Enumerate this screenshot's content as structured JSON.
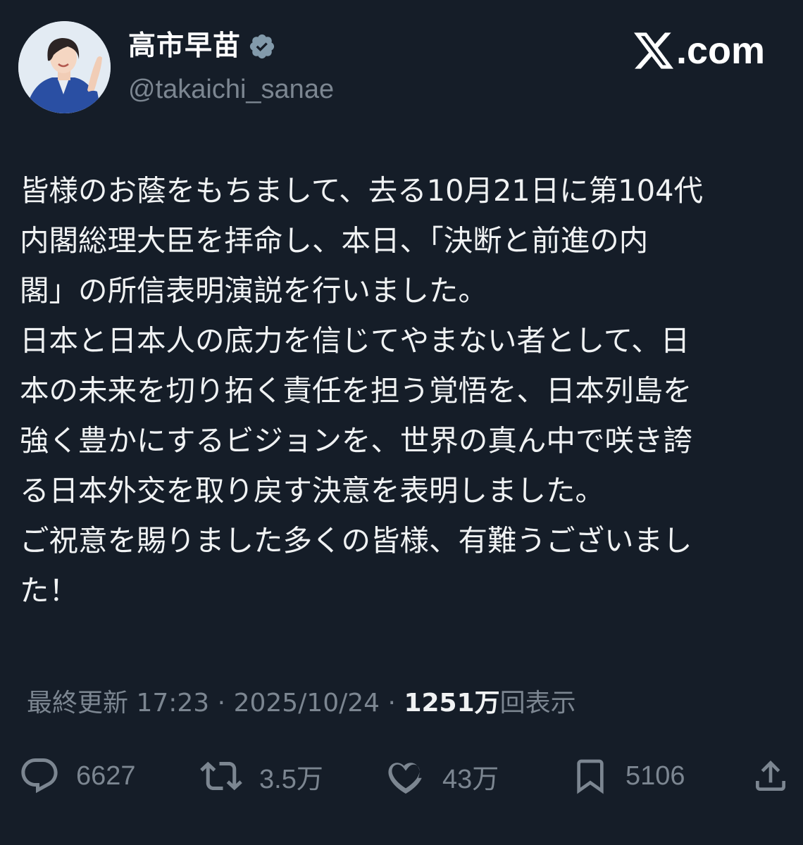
{
  "header": {
    "display_name": "高市早苗",
    "handle": "@takaichi_sanae",
    "brand": ".com"
  },
  "tweet": {
    "text": "皆様のお蔭をもちまして、去る10月21日に第104代\n内閣総理大臣を拝命し、本日、「決断と前進の内\n閣」の所信表明演説を行いました。\n日本と日本人の底力を信じてやまない者として、日\n本の未来を切り拓く責任を担う覚悟を、日本列島を\n強く豊かにするビジョンを、世界の真ん中で咲き誇\nる日本外交を取り戻す決意を表明しました。\nご祝意を賜りました多くの皆様、有難うございまし\nた！"
  },
  "meta": {
    "updated_label": "最終更新",
    "time": "17:23",
    "separator": "·",
    "date": "2025/10/24",
    "views_count": "1251万",
    "views_label": "回表示"
  },
  "actions": {
    "replies": "6627",
    "reposts": "3.5万",
    "likes": "43万",
    "bookmarks": "5106"
  },
  "colors": {
    "background": "#151d28",
    "text": "#f0f2f3",
    "muted": "#7c8691",
    "verified_badge": "#829aab"
  },
  "icons": [
    "verified-icon",
    "x-logo-icon",
    "reply-icon",
    "repost-icon",
    "like-icon",
    "bookmark-icon",
    "share-icon"
  ]
}
